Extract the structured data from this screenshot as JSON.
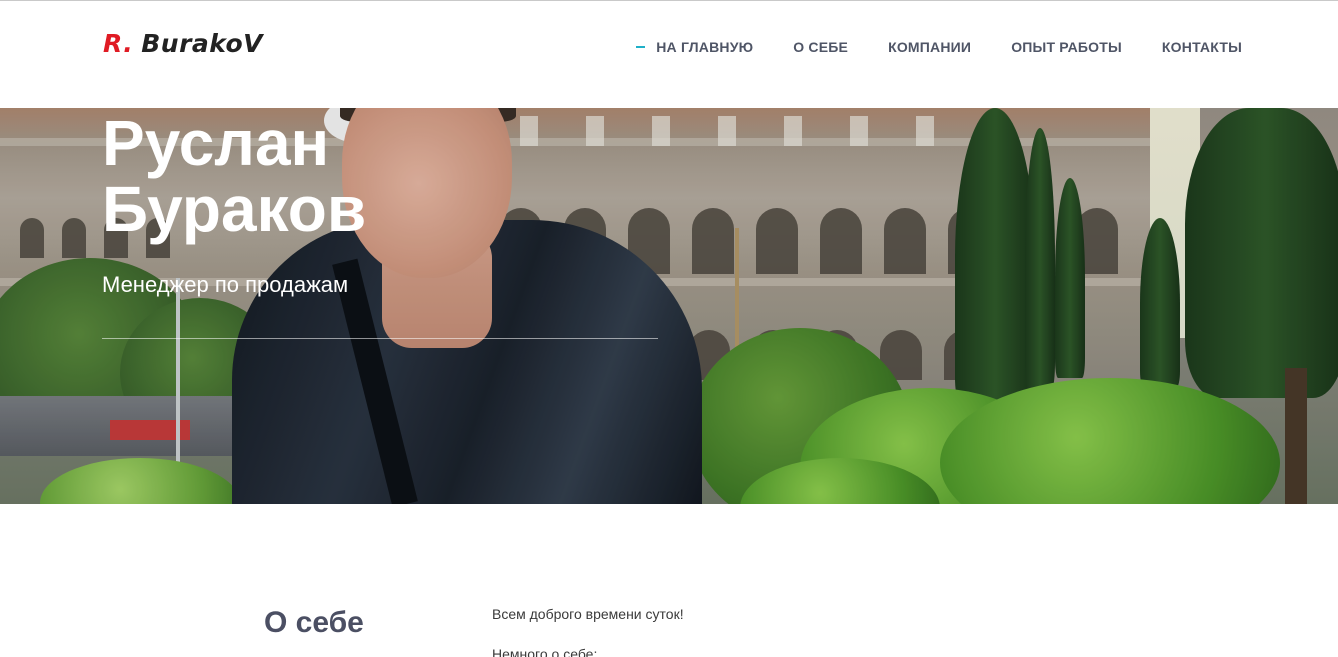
{
  "header": {
    "logo": {
      "prefix": "R.",
      "name": "BurakoV"
    },
    "nav": [
      {
        "label": "НА ГЛАВНУЮ",
        "active": true
      },
      {
        "label": "О СЕБЕ"
      },
      {
        "label": "КОМПАНИИ"
      },
      {
        "label": "ОПЫТ РАБОТЫ"
      },
      {
        "label": "КОНТАКТЫ"
      }
    ]
  },
  "hero": {
    "name_line1": "Руслан",
    "name_line2": "Бураков",
    "subtitle": "Менеджер по продажам"
  },
  "about": {
    "title": "О себе",
    "paragraph1": "Всем доброго времени суток!",
    "paragraph2": "Немного о себе:"
  },
  "colors": {
    "accent": "#1fb0c8",
    "logo_red": "#e01b24",
    "nav_text": "#4f5566",
    "heading": "#4b4f63"
  },
  "icons": {
    "active_nav_marker": "dash-marker"
  }
}
